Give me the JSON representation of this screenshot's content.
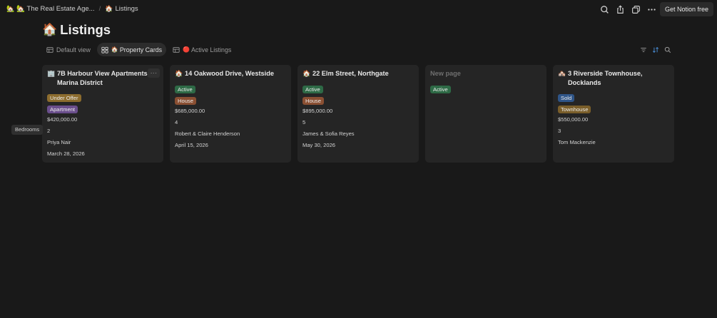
{
  "breadcrumb": {
    "workspace": "🏡 The Real Estate Age...",
    "workspace_icon": "🏡",
    "separator": "/",
    "page": "Listings",
    "page_icon": "🏠"
  },
  "topbar": {
    "icons": [
      "search-icon",
      "share-icon",
      "duplicate-icon",
      "more-icon"
    ],
    "cta_label": "Get Notion free"
  },
  "page": {
    "icon": "🏠",
    "title": "Listings"
  },
  "views": [
    {
      "label": "Default view",
      "icon": "table-icon",
      "emoji": "",
      "active": false
    },
    {
      "label": "Property Cards",
      "icon": "gallery-icon",
      "emoji": "🏠",
      "active": true
    },
    {
      "label": "Active Listings",
      "icon": "table-icon",
      "emoji": "🔴",
      "active": false
    }
  ],
  "view_tools": [
    "filter-icon",
    "sort-icon",
    "search-icon"
  ],
  "tooltip": "Bedrooms",
  "cards": [
    {
      "icon": "🏢",
      "title": "7B Harbour View Apartments, Marina District",
      "status": "Under Offer",
      "status_color": "#8c6c2e",
      "type": "Apartment",
      "type_color": "#6a4e8c",
      "price": "$420,000.00",
      "bedrooms": "2",
      "agent": "Priya Nair",
      "date": "March 28, 2026",
      "show_more": true,
      "more_label": "···"
    },
    {
      "icon": "🏠",
      "title": "14 Oakwood Drive, Westside",
      "status": "Active",
      "status_color": "#2e6a46",
      "type": "House",
      "type_color": "#8a4f32",
      "price": "$685,000.00",
      "bedrooms": "4",
      "agent": "Robert & Claire Henderson",
      "date": "April 15, 2026"
    },
    {
      "icon": "🏠",
      "title": "22 Elm Street, Northgate",
      "status": "Active",
      "status_color": "#2e6a46",
      "type": "House",
      "type_color": "#8a4f32",
      "price": "$895,000.00",
      "bedrooms": "5",
      "agent": "James & Sofia Reyes",
      "date": "May 30, 2026"
    },
    {
      "icon": "",
      "title": "New page",
      "placeholder": true,
      "status": "Active",
      "status_color": "#2e6a46"
    },
    {
      "icon": "🏘️",
      "title": "3 Riverside Townhouse, Docklands",
      "status": "Sold",
      "status_color": "#2f5588",
      "type": "Townhouse",
      "type_color": "#7a5e2a",
      "price": "$550,000.00",
      "bedrooms": "3",
      "agent": "Tom Mackenzie",
      "date": ""
    }
  ]
}
